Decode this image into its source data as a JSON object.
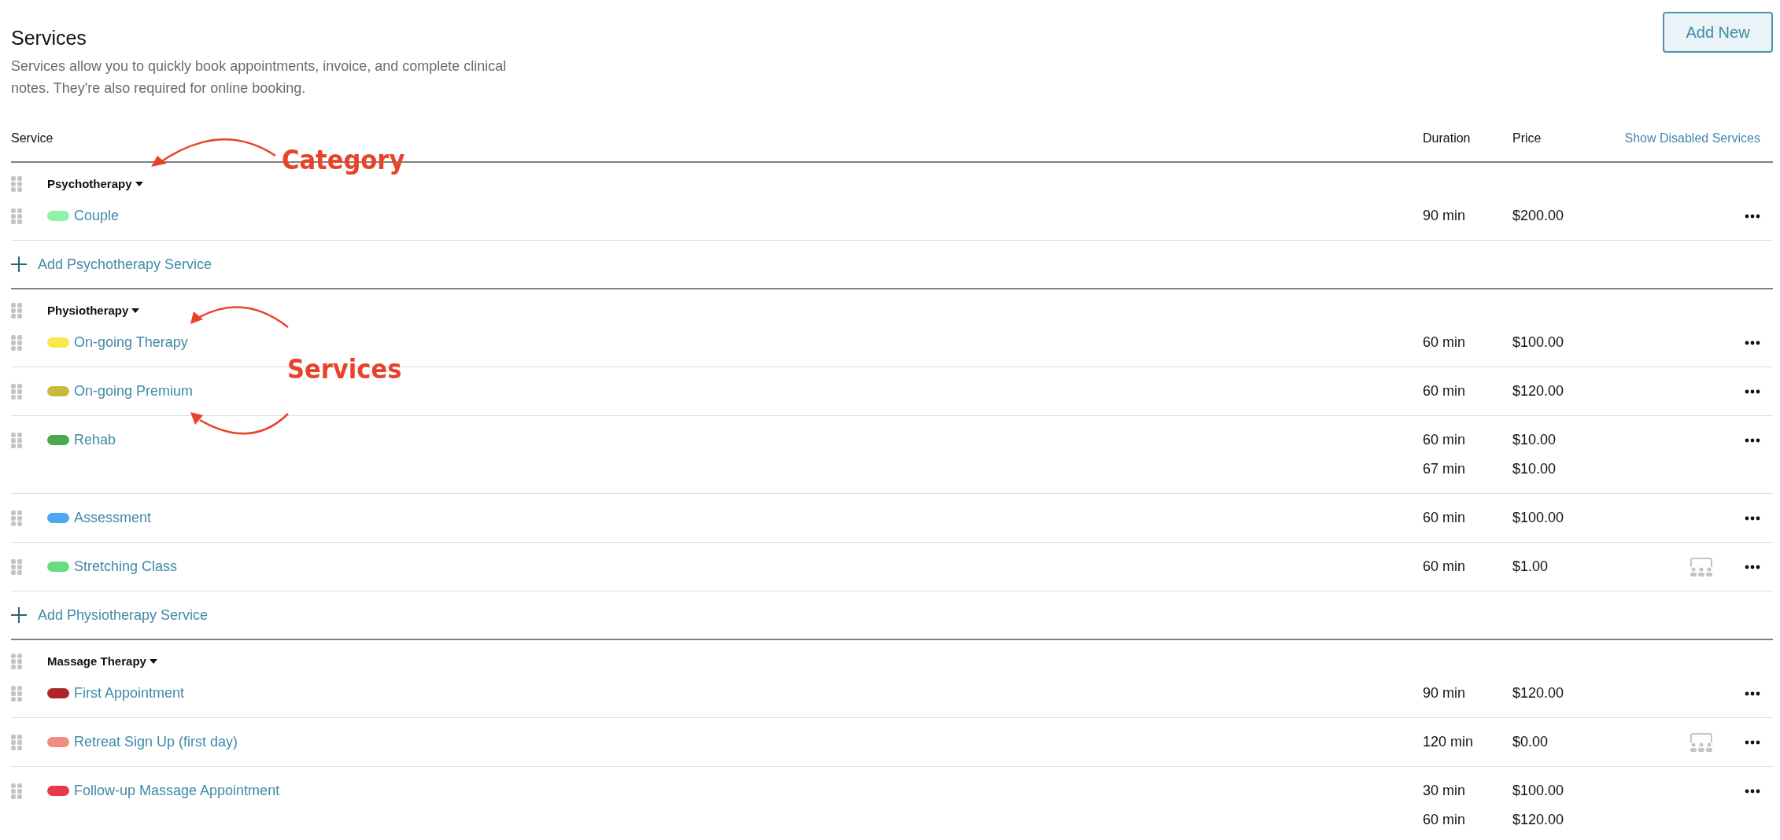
{
  "header": {
    "title": "Services",
    "description": "Services allow you to quickly book appointments, invoice, and complete clinical notes. They're also required for online booking.",
    "add_button": "Add New"
  },
  "columns": {
    "service": "Service",
    "duration": "Duration",
    "price": "Price",
    "show_disabled": "Show Disabled Services"
  },
  "categories": [
    {
      "name": "Psychotherapy",
      "add_label": "Add Psychotherapy Service",
      "services": [
        {
          "name": "Couple",
          "color": "#8ef2a8",
          "group_class": false,
          "rates": [
            {
              "duration": "90 min",
              "price": "$200.00"
            }
          ]
        }
      ]
    },
    {
      "name": "Physiotherapy",
      "add_label": "Add Physiotherapy Service",
      "services": [
        {
          "name": "On-going Therapy",
          "color": "#f8e84a",
          "group_class": false,
          "rates": [
            {
              "duration": "60 min",
              "price": "$100.00"
            }
          ]
        },
        {
          "name": "On-going Premium",
          "color": "#c9b83a",
          "group_class": false,
          "rates": [
            {
              "duration": "60 min",
              "price": "$120.00"
            }
          ]
        },
        {
          "name": "Rehab",
          "color": "#4aa84f",
          "group_class": false,
          "rates": [
            {
              "duration": "60 min",
              "price": "$10.00"
            },
            {
              "duration": "67 min",
              "price": "$10.00"
            }
          ]
        },
        {
          "name": "Assessment",
          "color": "#4aa8f5",
          "group_class": false,
          "rates": [
            {
              "duration": "60 min",
              "price": "$100.00"
            }
          ]
        },
        {
          "name": "Stretching Class",
          "color": "#66dd80",
          "group_class": true,
          "rates": [
            {
              "duration": "60 min",
              "price": "$1.00"
            }
          ]
        }
      ]
    },
    {
      "name": "Massage Therapy",
      "services": [
        {
          "name": "First Appointment",
          "color": "#b02428",
          "group_class": false,
          "rates": [
            {
              "duration": "90 min",
              "price": "$120.00"
            }
          ]
        },
        {
          "name": "Retreat Sign Up (first day)",
          "color": "#f08c80",
          "group_class": true,
          "rates": [
            {
              "duration": "120 min",
              "price": "$0.00"
            }
          ]
        },
        {
          "name": "Follow-up Massage Appointment",
          "color": "#e8384a",
          "group_class": false,
          "rates": [
            {
              "duration": "30 min",
              "price": "$100.00"
            },
            {
              "duration": "60 min",
              "price": "$120.00"
            }
          ]
        }
      ]
    }
  ],
  "annotations": [
    {
      "label": "Category"
    },
    {
      "label": "Services"
    }
  ]
}
